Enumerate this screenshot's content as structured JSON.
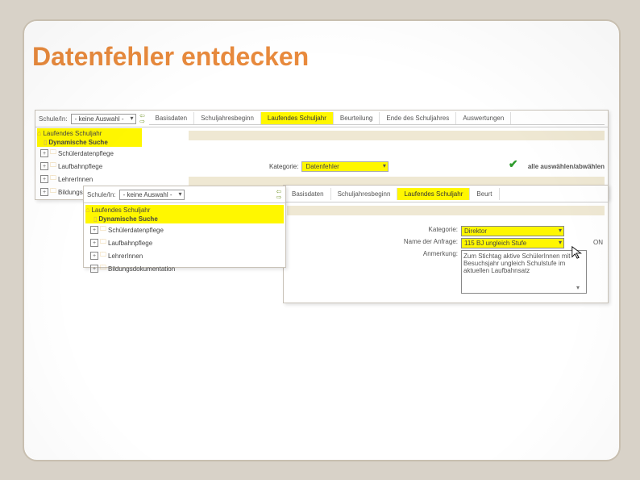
{
  "title": "Datenfehler entdecken",
  "ss1": {
    "schuleLabel": "Schule/In:",
    "auswahl": "- keine Auswahl -",
    "tabs": [
      "Basisdaten",
      "Schuljahresbeginn",
      "Laufendes Schuljahr",
      "Beurteilung",
      "Ende des Schuljahres",
      "Auswertungen"
    ],
    "highlightTab": "Laufendes Schuljahr",
    "tree": {
      "rootHl": "Laufendes Schuljahr",
      "dyn": "Dynamische Suche",
      "items": [
        "Schülerdatenpflege",
        "Laufbahnpflege",
        "LehrerInnen",
        "Bildungsdokumentation"
      ]
    },
    "kategorieLabel": "Kategorie:",
    "kategorieValue": "Datenfehler",
    "alleLabel": "alle auswählen/abwählen"
  },
  "ss2": {
    "schuleLabel": "Schule/In:",
    "auswahl": "- keine Auswahl -",
    "tree": {
      "rootHl": "Laufendes Schuljahr",
      "dyn": "Dynamische Suche",
      "items": [
        "Schülerdatenpflege",
        "Laufbahnpflege",
        "LehrerInnen",
        "Bildungsdokumentation"
      ]
    }
  },
  "ss3": {
    "tabs": [
      "Basisdaten",
      "Schuljahresbeginn",
      "Laufendes Schuljahr",
      "Beurt"
    ],
    "highlightTab": "Laufendes Schuljahr",
    "kategorieLabel": "Kategorie:",
    "kategorieValue": "Direktor",
    "nameLabel": "Name der Anfrage:",
    "nameValue": "115 BJ ungleich Stufe",
    "anmLabel": "Anmerkung:",
    "anmValue": "Zum Stichtag aktive SchülerInnen mit Besuchsjahr ungleich Schulstufe im aktuellen Laufbahnsatz",
    "onText": "ON"
  }
}
